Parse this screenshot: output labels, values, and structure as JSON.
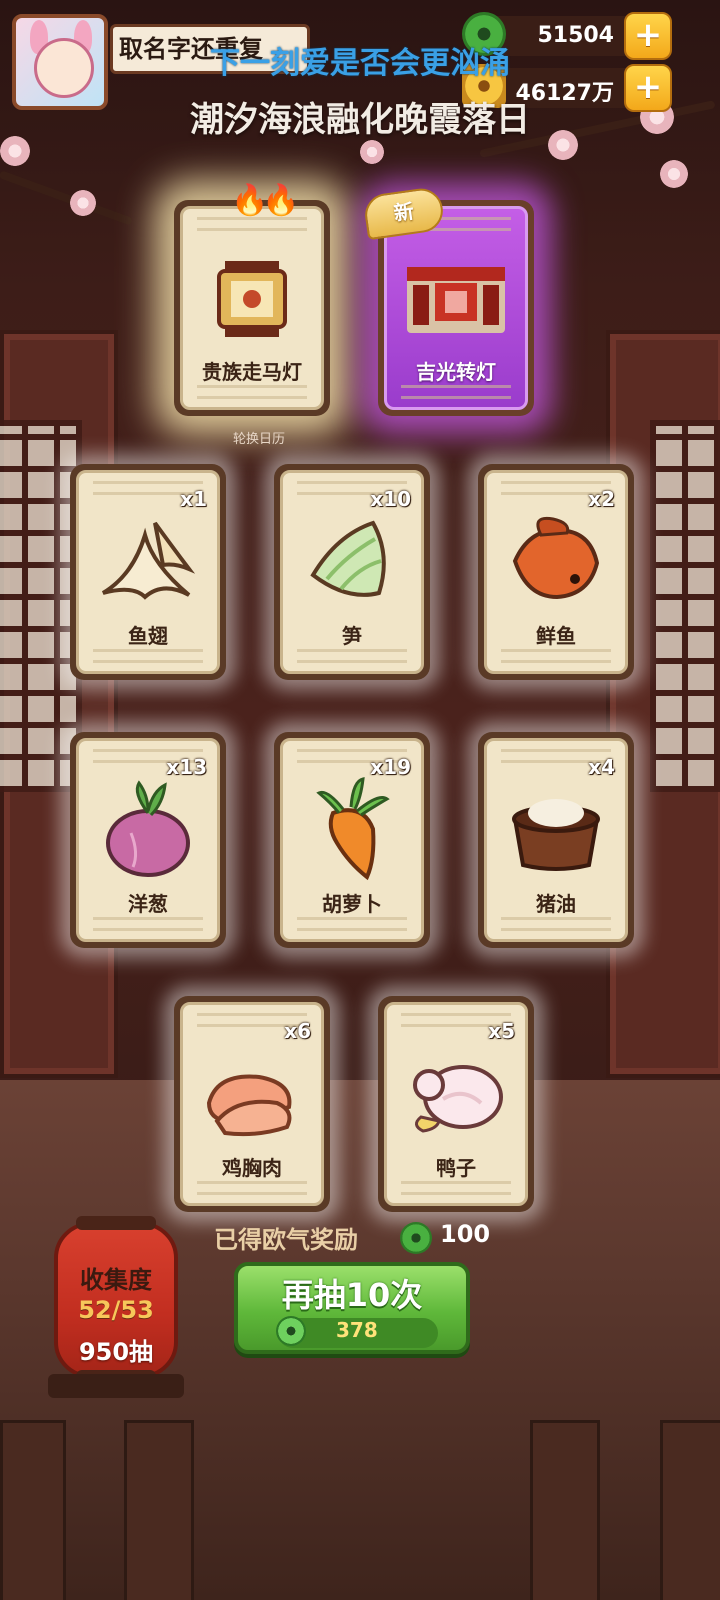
{
  "player": {
    "name": "取名字还重复"
  },
  "currencies": {
    "jade": "51504",
    "gold": "46127万"
  },
  "overlay": {
    "line1": "下一刻爱是否会更汹涌",
    "line2": "潮汐海浪融化晚霞落日"
  },
  "featured_cards": [
    {
      "name": "贵族走马灯",
      "badge": "",
      "icon": "lantern-icon"
    },
    {
      "name": "吉光转灯",
      "badge": "新",
      "icon": "stage-scene-icon"
    }
  ],
  "calendar_caption": "轮换日历",
  "cards": [
    {
      "name": "鱼翅",
      "qty": "x1",
      "icon": "shark-fin-icon"
    },
    {
      "name": "笋",
      "qty": "x10",
      "icon": "bamboo-shoot-icon"
    },
    {
      "name": "鲜鱼",
      "qty": "x2",
      "icon": "fish-icon"
    },
    {
      "name": "洋葱",
      "qty": "x13",
      "icon": "onion-icon"
    },
    {
      "name": "胡萝卜",
      "qty": "x19",
      "icon": "carrot-icon"
    },
    {
      "name": "猪油",
      "qty": "x4",
      "icon": "lard-icon"
    },
    {
      "name": "鸡胸肉",
      "qty": "x6",
      "icon": "chicken-breast-icon"
    },
    {
      "name": "鸭子",
      "qty": "x5",
      "icon": "duck-icon"
    }
  ],
  "rewards": {
    "label": "已得欧气奖励",
    "value": "100"
  },
  "draw_button": {
    "label": "再抽10次",
    "cost": "378"
  },
  "collection": {
    "label": "收集度",
    "progress": "52/53",
    "draws": "950抽"
  },
  "colors": {
    "accent_green": "#5fb83a",
    "rare_purple": "#b04ed8",
    "gold": "#f3a81a"
  }
}
